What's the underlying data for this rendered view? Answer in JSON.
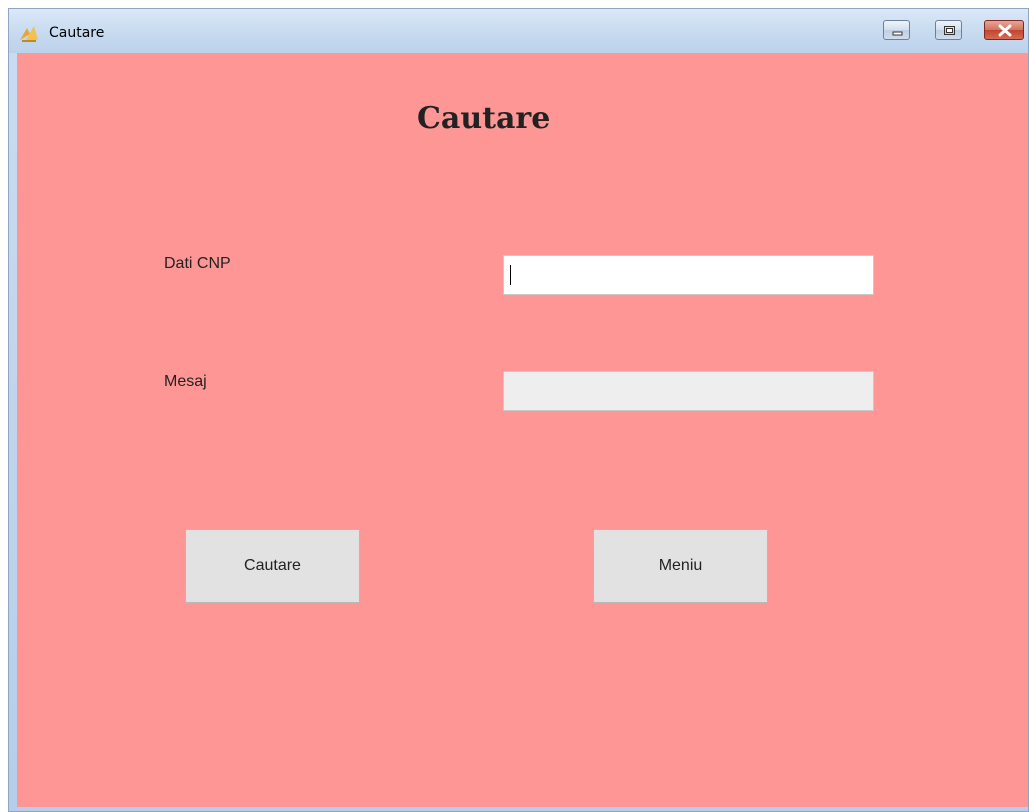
{
  "window": {
    "title": "Cautare",
    "controls": {
      "minimize_icon": "minimize-icon",
      "maximize_icon": "maximize-icon",
      "close_icon": "close-icon"
    }
  },
  "form": {
    "heading": "Cautare",
    "cnp_label": "Dati CNP",
    "cnp_value": "",
    "message_label": "Mesaj",
    "message_value": "",
    "search_button": "Cautare",
    "menu_button": "Meniu"
  },
  "colors": {
    "background": "#ff9696",
    "button": "#e2e2e2",
    "readonly_field": "#eeeeee"
  }
}
